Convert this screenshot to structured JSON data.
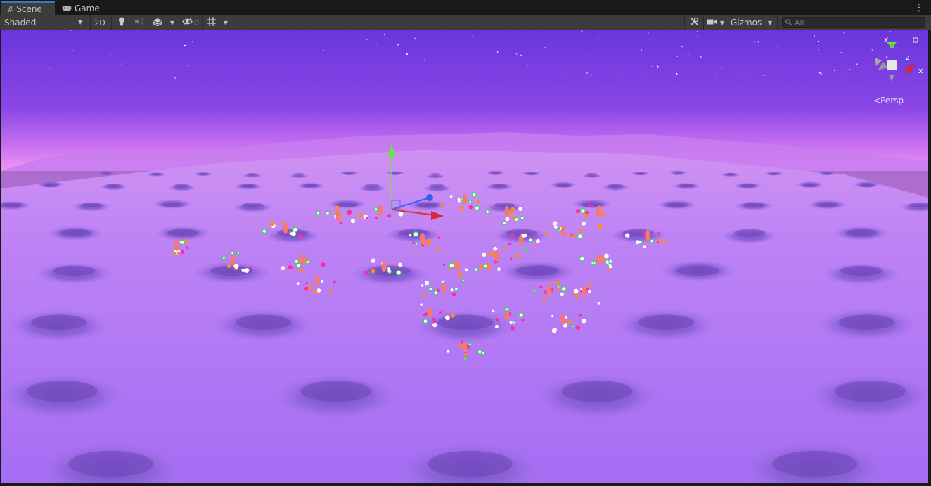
{
  "tabs": [
    {
      "label": "Scene",
      "icon": "grid-icon"
    },
    {
      "label": "Game",
      "icon": "gamepad-icon"
    }
  ],
  "toolbar": {
    "shading_mode": "Shaded",
    "mode_2d_label": "2D",
    "hidden_count": "0",
    "gizmos_label": "Gizmos",
    "search_placeholder": "All"
  },
  "view_gizmo": {
    "axis_y": "y",
    "axis_z": "z",
    "axis_x": "x",
    "projection_label": "Persp"
  },
  "colors": {
    "sky_top": "#6e3ae0",
    "sky_horizon": "#e38cf2",
    "ground": "#b078f5",
    "gizmo_y": "#5fd03c",
    "gizmo_x": "#d8263a",
    "gizmo_z": "#3a5ae8",
    "accent_tab": "#3a79bb"
  }
}
